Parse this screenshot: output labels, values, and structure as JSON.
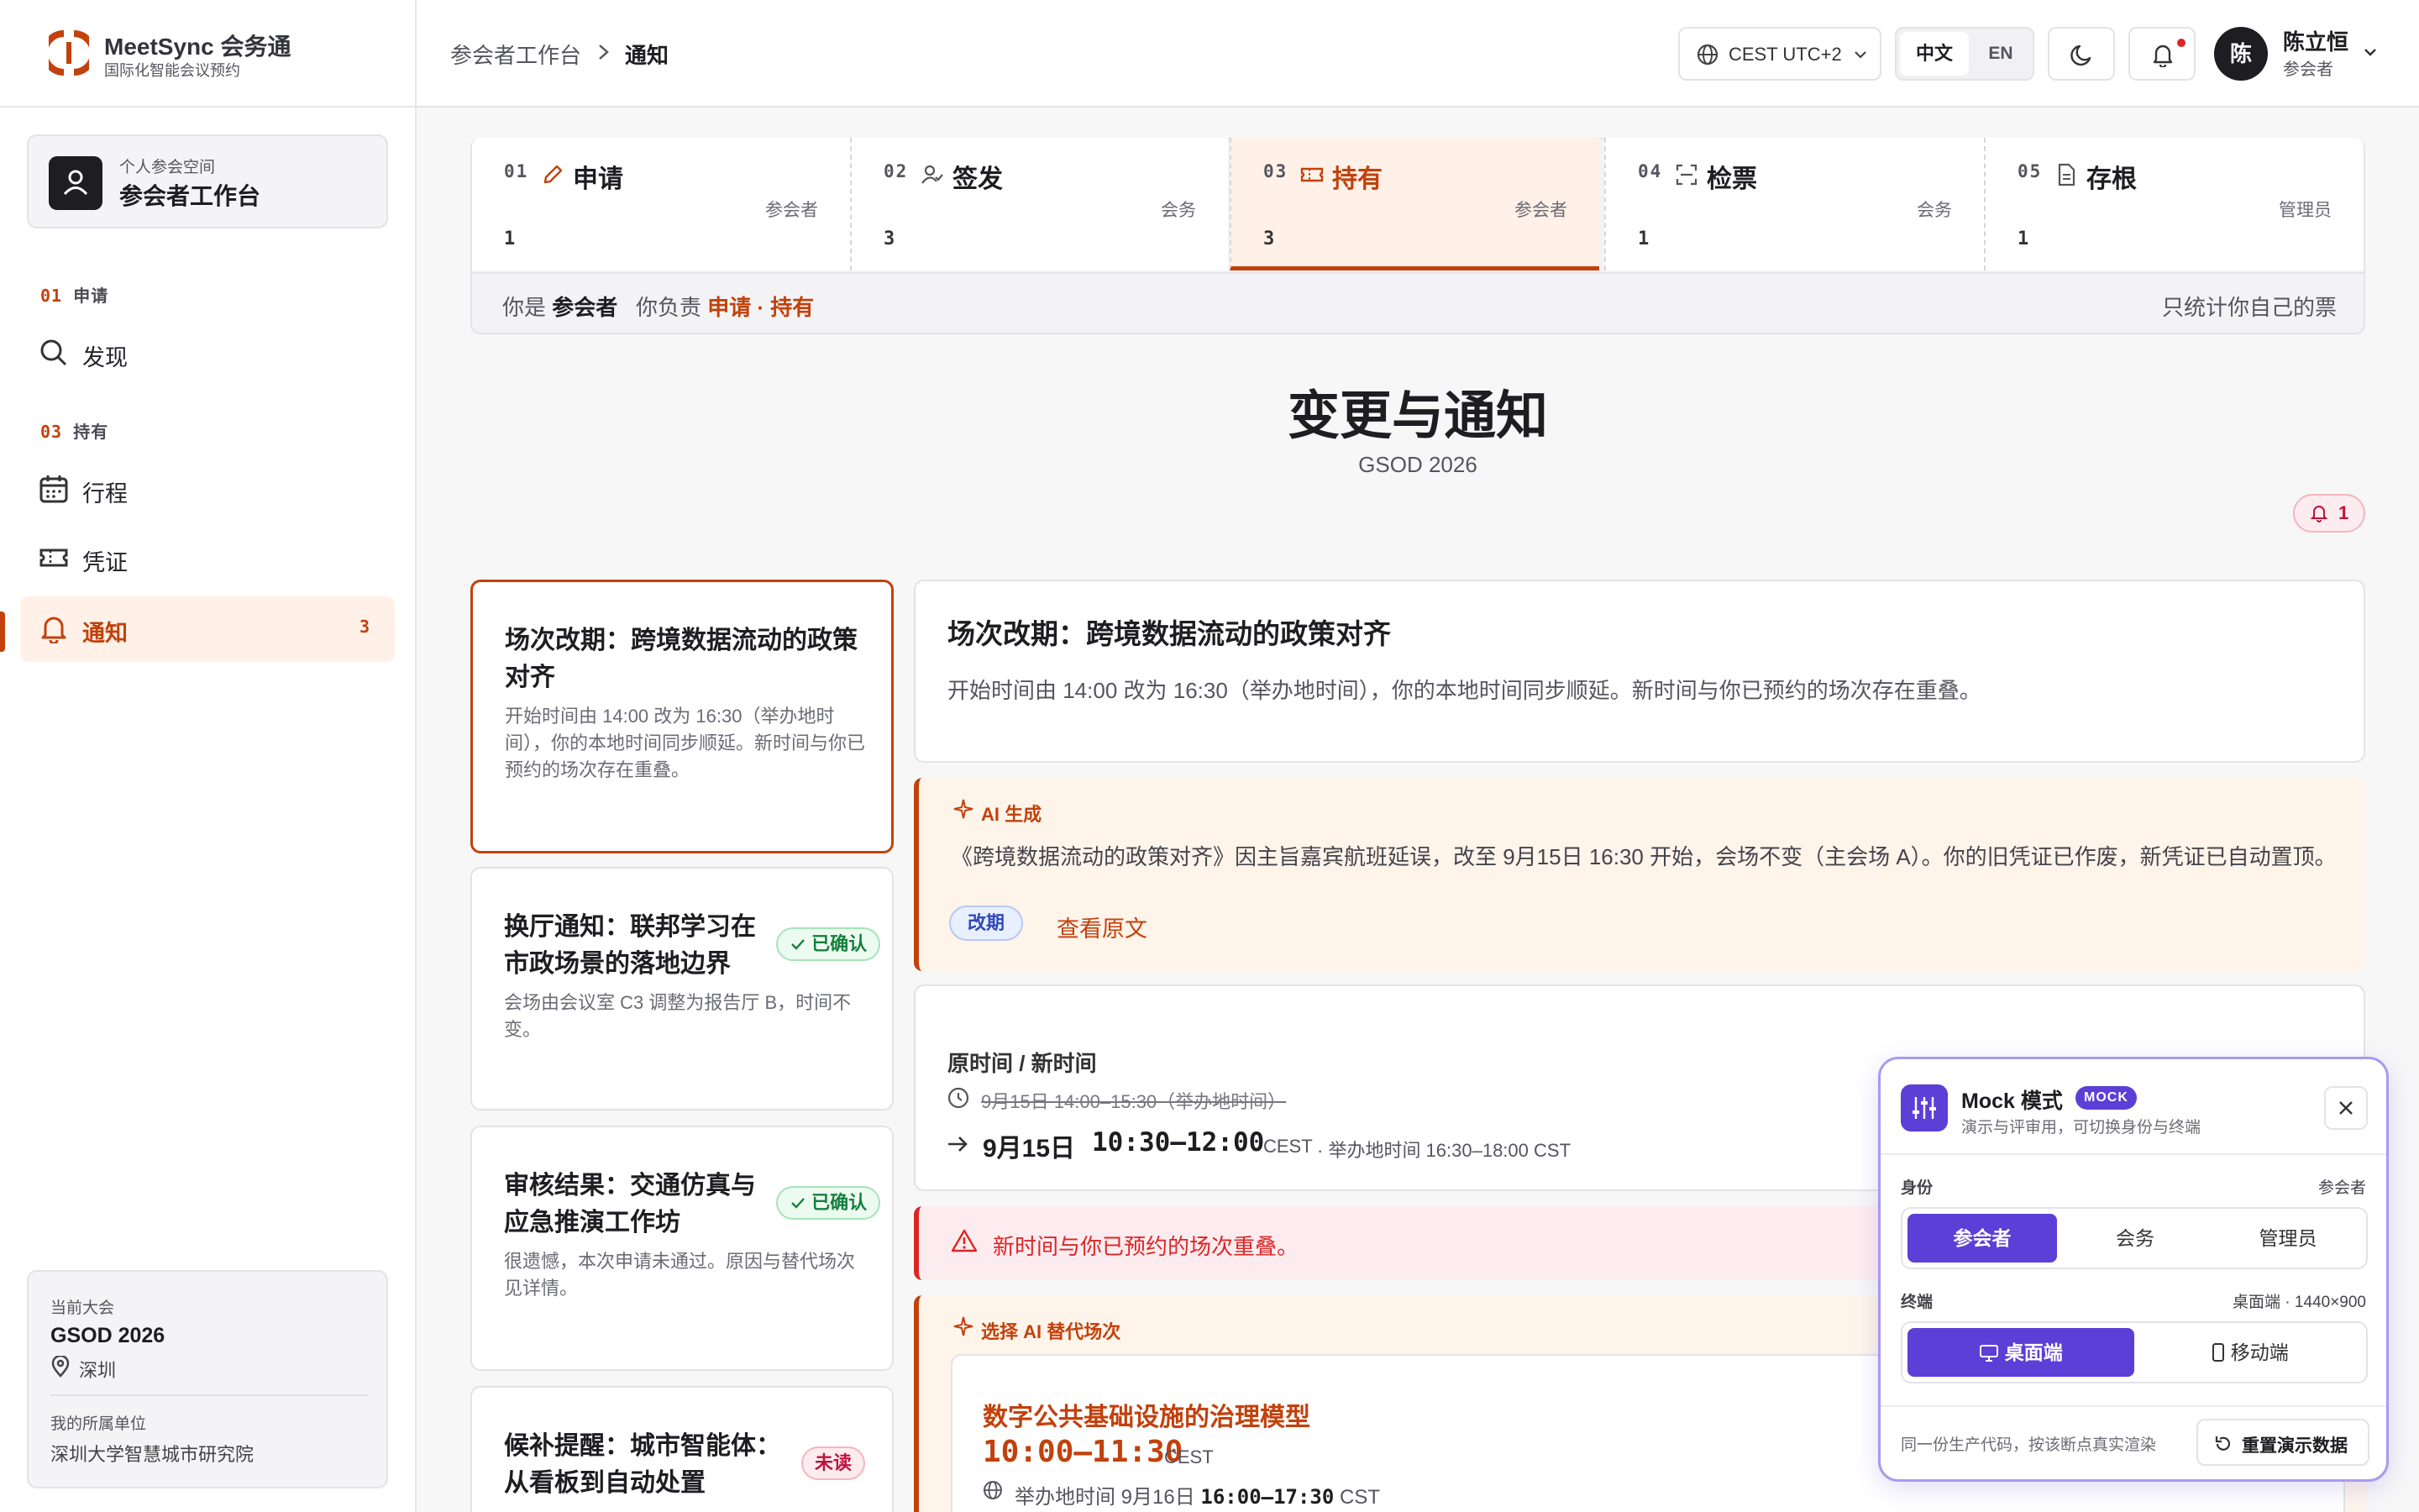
{
  "brand": {
    "logo_text": "MeetSync 会务通",
    "subtitle": "国际化智能会议预约"
  },
  "workspace": {
    "caption": "个人参会空间",
    "title": "参会者工作台"
  },
  "sidebar": {
    "sections": [
      {
        "num": "01",
        "label": "申请"
      },
      {
        "num": "03",
        "label": "持有"
      }
    ],
    "items": [
      {
        "label": "发现",
        "icon": "search-icon"
      },
      {
        "label": "行程",
        "icon": "calendar-icon"
      },
      {
        "label": "凭证",
        "icon": "ticket-icon"
      },
      {
        "label": "通知",
        "icon": "bell-icon",
        "count": "3",
        "active": true
      }
    ],
    "footer": {
      "conf_caption": "当前大会",
      "conf_name": "GSOD 2026",
      "conf_city": "深圳",
      "org_caption": "我的所属单位",
      "org_name": "深圳大学智慧城市研究院"
    }
  },
  "header": {
    "breadcrumb": [
      "参会者工作台",
      "通知"
    ],
    "timezone": "CEST UTC+2",
    "lang": {
      "zh": "中文",
      "en": "EN",
      "active": "zh"
    },
    "user": {
      "avatar": "陈",
      "name": "陈立恒",
      "role": "参会者"
    }
  },
  "stepper": {
    "steps": [
      {
        "num": "01",
        "title": "申请",
        "role": "参会者",
        "count": "1",
        "icon": "pencil-icon",
        "highlight_role": true
      },
      {
        "num": "02",
        "title": "签发",
        "role": "会务",
        "count": "3",
        "icon": "user-check-icon"
      },
      {
        "num": "03",
        "title": "持有",
        "role": "参会者",
        "count": "3",
        "icon": "ticket-icon",
        "active": true,
        "highlight_role": true
      },
      {
        "num": "04",
        "title": "检票",
        "role": "会务",
        "count": "1",
        "icon": "scan-icon"
      },
      {
        "num": "05",
        "title": "存根",
        "role": "管理员",
        "count": "1",
        "icon": "file-icon"
      }
    ],
    "info": {
      "you_are": "你是",
      "role": "参会者",
      "responsible": "你负责",
      "tasks": "申请 · 持有",
      "note": "只统计你自己的票"
    }
  },
  "page": {
    "title": "变更与通知",
    "subtitle": "GSOD 2026",
    "bell_count": "1"
  },
  "notifications": [
    {
      "title": "场次改期：跨境数据流动的政策对齐",
      "desc": "开始时间由 14:00 改为 16:30（举办地时间），你的本地时间同步顺延。新时间与你已预约的场次存在重叠。",
      "selected": true
    },
    {
      "title": "换厅通知：联邦学习在市政场景的落地边界",
      "desc": "会场由会议室 C3 调整为报告厅 B，时间不变。",
      "badge": "已确认",
      "badge_type": "ok"
    },
    {
      "title": "审核结果：交通仿真与应急推演工作坊",
      "desc": "很遗憾，本次申请未通过。原因与替代场次见详情。",
      "badge": "已确认",
      "badge_type": "ok"
    },
    {
      "title": "候补提醒：城市智能体：从看板到自动处置",
      "desc": "",
      "badge": "未读",
      "badge_type": "unread"
    }
  ],
  "detail": {
    "title": "场次改期：跨境数据流动的政策对齐",
    "desc": "开始时间由 14:00 改为 16:30（举办地时间），你的本地时间同步顺延。新时间与你已预约的场次存在重叠。",
    "ai": {
      "label": "AI 生成",
      "text": "《跨境数据流动的政策对齐》因主旨嘉宾航班延误，改至 9月15日 16:30 开始，会场不变（主会场 A）。你的旧凭证已作废，新凭证已自动置顶。",
      "tag": "改期",
      "link": "查看原文"
    },
    "time": {
      "heading": "原时间 / 新时间",
      "old": "9月15日 14:00–15:30（举办地时间）",
      "new_date": "9月15日",
      "new_time": "10:30–12:00",
      "new_tz": "CEST",
      "new_venue": "· 举办地时间 16:30–18:00 CST"
    },
    "warning": "新时间与你已预约的场次重叠。",
    "alt": {
      "label": "选择 AI 替代场次",
      "title": "数字公共基础设施的治理模型",
      "time": "10:00–11:30",
      "tz": "CEST",
      "venue_caption": "举办地时间",
      "venue_date": "9月16日",
      "venue_time": "16:00–17:30",
      "venue_tz": "CST"
    }
  },
  "mock": {
    "title": "Mock 模式",
    "tag": "MOCK",
    "subtitle": "演示与评审用，可切换身份与终端",
    "identity": {
      "label": "身份",
      "current": "参会者",
      "options": [
        "参会者",
        "会务",
        "管理员"
      ]
    },
    "terminal": {
      "label": "终端",
      "current": "桌面端 · 1440×900",
      "options": [
        "桌面端",
        "移动端"
      ]
    },
    "footer_note": "同一份生产代码，按该断点真实渲染",
    "reset": "重置演示数据"
  },
  "colors": {
    "accent": "#c2410c",
    "accent_bg": "#fff1e8",
    "purple": "#5b3fd6",
    "danger": "#dc2626",
    "success": "#15803d"
  }
}
